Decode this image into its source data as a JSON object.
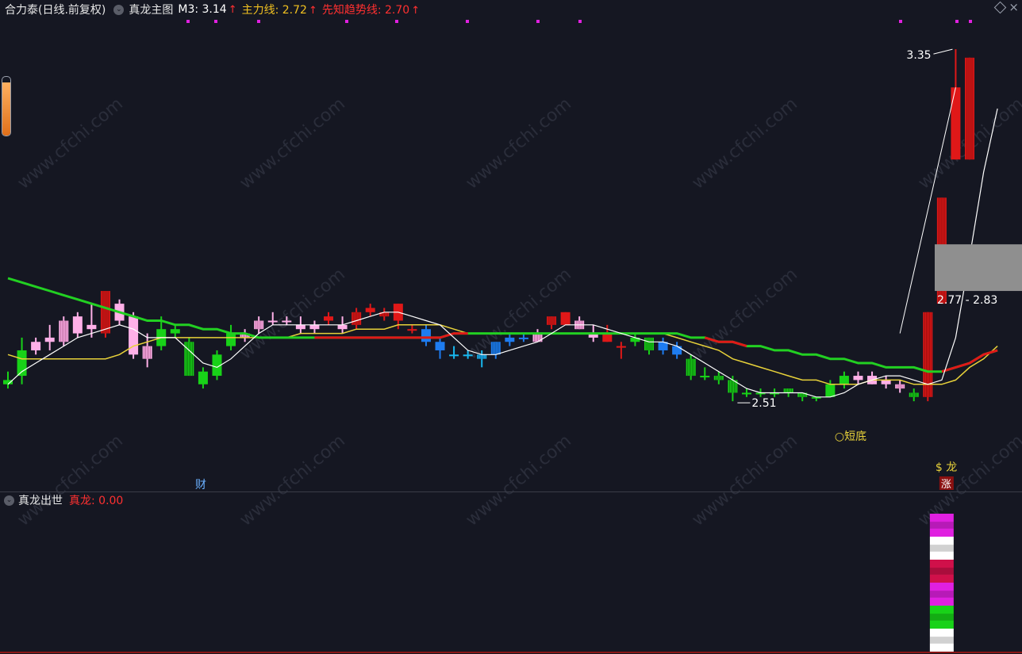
{
  "header": {
    "stock": "合力泰(日线.前复权)",
    "indicator": "真龙主图",
    "m3_label": "M3: 3.14",
    "m3_arrow": "↑",
    "main_label": "主力线: 2.72",
    "main_arrow": "↑",
    "trend_label": "先知趋势线: 2.70",
    "trend_arrow": "↑"
  },
  "sub": {
    "title": "真龙出世",
    "value_label": "真龙: 0.00"
  },
  "watermark": "www.cfchi.com",
  "colors": {
    "background": "#151722",
    "m3": "#ffffff",
    "main_line": "#e8d23a",
    "trend_green": "#22d022",
    "trend_red": "#e01818",
    "header_trend": "#ff3030",
    "header_main": "#f0c020"
  },
  "chart_data": {
    "type": "candlestick",
    "y_range": [
      2.4,
      3.4
    ],
    "price_labels": {
      "high": "3.35",
      "low": "2.51",
      "range": "2.77 - 2.83"
    },
    "signals": {
      "short_bottom": "○短底",
      "dragon": "$ 龙",
      "rise": "涨",
      "cai": "财"
    },
    "candles": [
      {
        "o": 2.55,
        "h": 2.58,
        "l": 2.54,
        "c": 2.56,
        "s": "green"
      },
      {
        "o": 2.57,
        "h": 2.66,
        "l": 2.55,
        "c": 2.63,
        "s": "green"
      },
      {
        "o": 2.63,
        "h": 2.66,
        "l": 2.62,
        "c": 2.65,
        "s": "pink"
      },
      {
        "o": 2.65,
        "h": 2.69,
        "l": 2.63,
        "c": 2.66,
        "s": "pink"
      },
      {
        "o": 2.65,
        "h": 2.71,
        "l": 2.64,
        "c": 2.7,
        "s": "pinkh"
      },
      {
        "o": 2.67,
        "h": 2.72,
        "l": 2.66,
        "c": 2.71,
        "s": "pink"
      },
      {
        "o": 2.69,
        "h": 2.74,
        "l": 2.66,
        "c": 2.68,
        "s": "pink"
      },
      {
        "o": 2.67,
        "h": 2.77,
        "l": 2.66,
        "c": 2.77,
        "s": "redh"
      },
      {
        "o": 2.7,
        "h": 2.75,
        "l": 2.69,
        "c": 2.74,
        "s": "pink"
      },
      {
        "o": 2.62,
        "h": 2.72,
        "l": 2.61,
        "c": 2.71,
        "s": "pink"
      },
      {
        "o": 2.61,
        "h": 2.67,
        "l": 2.59,
        "c": 2.64,
        "s": "pinkh"
      },
      {
        "o": 2.64,
        "h": 2.71,
        "l": 2.63,
        "c": 2.68,
        "s": "green"
      },
      {
        "o": 2.68,
        "h": 2.69,
        "l": 2.66,
        "c": 2.67,
        "s": "green"
      },
      {
        "o": 2.65,
        "h": 2.66,
        "l": 2.57,
        "c": 2.57,
        "s": "greenh"
      },
      {
        "o": 2.55,
        "h": 2.59,
        "l": 2.54,
        "c": 2.58,
        "s": "green"
      },
      {
        "o": 2.57,
        "h": 2.63,
        "l": 2.56,
        "c": 2.62,
        "s": "green"
      },
      {
        "o": 2.64,
        "h": 2.69,
        "l": 2.63,
        "c": 2.67,
        "s": "green"
      },
      {
        "o": 2.66,
        "h": 2.68,
        "l": 2.65,
        "c": 2.67,
        "s": "pinkh"
      },
      {
        "o": 2.68,
        "h": 2.71,
        "l": 2.67,
        "c": 2.7,
        "s": "pinkh"
      },
      {
        "o": 2.7,
        "h": 2.72,
        "l": 2.69,
        "c": 2.7,
        "s": "pink"
      },
      {
        "o": 2.7,
        "h": 2.71,
        "l": 2.69,
        "c": 2.7,
        "s": "pink"
      },
      {
        "o": 2.69,
        "h": 2.71,
        "l": 2.67,
        "c": 2.68,
        "s": "pink"
      },
      {
        "o": 2.69,
        "h": 2.7,
        "l": 2.67,
        "c": 2.68,
        "s": "pink"
      },
      {
        "o": 2.7,
        "h": 2.72,
        "l": 2.69,
        "c": 2.71,
        "s": "red"
      },
      {
        "o": 2.69,
        "h": 2.71,
        "l": 2.67,
        "c": 2.68,
        "s": "pink"
      },
      {
        "o": 2.69,
        "h": 2.73,
        "l": 2.68,
        "c": 2.72,
        "s": "redh"
      },
      {
        "o": 2.72,
        "h": 2.74,
        "l": 2.71,
        "c": 2.73,
        "s": "red"
      },
      {
        "o": 2.71,
        "h": 2.73,
        "l": 2.7,
        "c": 2.72,
        "s": "redh"
      },
      {
        "o": 2.7,
        "h": 2.74,
        "l": 2.68,
        "c": 2.74,
        "s": "red"
      },
      {
        "o": 2.68,
        "h": 2.69,
        "l": 2.67,
        "c": 2.68,
        "s": "red"
      },
      {
        "o": 2.68,
        "h": 2.69,
        "l": 2.64,
        "c": 2.65,
        "s": "blue"
      },
      {
        "o": 2.65,
        "h": 2.66,
        "l": 2.61,
        "c": 2.63,
        "s": "blue"
      },
      {
        "o": 2.62,
        "h": 2.64,
        "l": 2.61,
        "c": 2.62,
        "s": "cyan"
      },
      {
        "o": 2.62,
        "h": 2.63,
        "l": 2.61,
        "c": 2.62,
        "s": "cyan"
      },
      {
        "o": 2.61,
        "h": 2.63,
        "l": 2.59,
        "c": 2.62,
        "s": "cyanh"
      },
      {
        "o": 2.62,
        "h": 2.65,
        "l": 2.61,
        "c": 2.65,
        "s": "blueh"
      },
      {
        "o": 2.65,
        "h": 2.67,
        "l": 2.64,
        "c": 2.66,
        "s": "blue"
      },
      {
        "o": 2.66,
        "h": 2.67,
        "l": 2.65,
        "c": 2.66,
        "s": "blue"
      },
      {
        "o": 2.65,
        "h": 2.68,
        "l": 2.65,
        "c": 2.67,
        "s": "pinkh"
      },
      {
        "o": 2.69,
        "h": 2.71,
        "l": 2.68,
        "c": 2.71,
        "s": "redh"
      },
      {
        "o": 2.69,
        "h": 2.72,
        "l": 2.69,
        "c": 2.72,
        "s": "red"
      },
      {
        "o": 2.7,
        "h": 2.71,
        "l": 2.68,
        "c": 2.68,
        "s": "pinkh"
      },
      {
        "o": 2.67,
        "h": 2.69,
        "l": 2.65,
        "c": 2.66,
        "s": "pink"
      },
      {
        "o": 2.67,
        "h": 2.69,
        "l": 2.65,
        "c": 2.65,
        "s": "red"
      },
      {
        "o": 2.64,
        "h": 2.65,
        "l": 2.61,
        "c": 2.64,
        "s": "red"
      },
      {
        "o": 2.65,
        "h": 2.67,
        "l": 2.64,
        "c": 2.66,
        "s": "green"
      },
      {
        "o": 2.66,
        "h": 2.66,
        "l": 2.62,
        "c": 2.63,
        "s": "greenh"
      },
      {
        "o": 2.65,
        "h": 2.66,
        "l": 2.62,
        "c": 2.63,
        "s": "blue"
      },
      {
        "o": 2.64,
        "h": 2.65,
        "l": 2.61,
        "c": 2.62,
        "s": "blue"
      },
      {
        "o": 2.61,
        "h": 2.62,
        "l": 2.56,
        "c": 2.57,
        "s": "greenh"
      },
      {
        "o": 2.57,
        "h": 2.59,
        "l": 2.56,
        "c": 2.57,
        "s": "green"
      },
      {
        "o": 2.57,
        "h": 2.58,
        "l": 2.55,
        "c": 2.56,
        "s": "greenh"
      },
      {
        "o": 2.56,
        "h": 2.57,
        "l": 2.51,
        "c": 2.53,
        "s": "greenh"
      },
      {
        "o": 2.53,
        "h": 2.54,
        "l": 2.52,
        "c": 2.53,
        "s": "green"
      },
      {
        "o": 2.53,
        "h": 2.54,
        "l": 2.52,
        "c": 2.53,
        "s": "green"
      },
      {
        "o": 2.53,
        "h": 2.54,
        "l": 2.52,
        "c": 2.53,
        "s": "green"
      },
      {
        "o": 2.53,
        "h": 2.54,
        "l": 2.52,
        "c": 2.54,
        "s": "greenh"
      },
      {
        "o": 2.53,
        "h": 2.53,
        "l": 2.51,
        "c": 2.52,
        "s": "greenh"
      },
      {
        "o": 2.52,
        "h": 2.52,
        "l": 2.51,
        "c": 2.52,
        "s": "green"
      },
      {
        "o": 2.52,
        "h": 2.56,
        "l": 2.52,
        "c": 2.55,
        "s": "green"
      },
      {
        "o": 2.55,
        "h": 2.58,
        "l": 2.54,
        "c": 2.57,
        "s": "green"
      },
      {
        "o": 2.56,
        "h": 2.58,
        "l": 2.55,
        "c": 2.57,
        "s": "pink"
      },
      {
        "o": 2.55,
        "h": 2.58,
        "l": 2.55,
        "c": 2.57,
        "s": "pink"
      },
      {
        "o": 2.55,
        "h": 2.57,
        "l": 2.54,
        "c": 2.56,
        "s": "pink"
      },
      {
        "o": 2.54,
        "h": 2.56,
        "l": 2.53,
        "c": 2.55,
        "s": "pinkh"
      },
      {
        "o": 2.52,
        "h": 2.54,
        "l": 2.51,
        "c": 2.53,
        "s": "greenh"
      },
      {
        "o": 2.52,
        "h": 2.72,
        "l": 2.51,
        "c": 2.72,
        "s": "redh"
      },
      {
        "o": 2.74,
        "h": 2.99,
        "l": 2.74,
        "c": 2.99,
        "s": "redh"
      },
      {
        "o": 3.08,
        "h": 3.34,
        "l": 3.08,
        "c": 3.25,
        "s": "red"
      },
      {
        "o": 3.08,
        "h": 3.32,
        "l": 3.08,
        "c": 3.32,
        "s": "redh"
      }
    ],
    "m3": [
      2.55,
      2.58,
      2.6,
      2.62,
      2.64,
      2.66,
      2.67,
      2.68,
      2.69,
      2.68,
      2.66,
      2.66,
      2.66,
      2.63,
      2.6,
      2.59,
      2.61,
      2.64,
      2.67,
      2.69,
      2.69,
      2.69,
      2.69,
      2.69,
      2.69,
      2.7,
      2.71,
      2.72,
      2.72,
      2.71,
      2.7,
      2.69,
      2.66,
      2.63,
      2.62,
      2.62,
      2.63,
      2.64,
      2.65,
      2.67,
      2.69,
      2.69,
      2.69,
      2.68,
      2.67,
      2.66,
      2.65,
      2.65,
      2.64,
      2.62,
      2.6,
      2.58,
      2.56,
      2.54,
      2.53,
      2.53,
      2.53,
      2.53,
      2.52,
      2.52,
      2.53,
      2.55,
      2.56,
      2.57,
      2.57,
      2.56,
      2.55,
      2.56,
      2.66,
      2.85,
      3.05,
      3.2
    ],
    "main_line": [
      2.62,
      2.61,
      2.61,
      2.61,
      2.61,
      2.61,
      2.61,
      2.61,
      2.62,
      2.64,
      2.65,
      2.66,
      2.66,
      2.66,
      2.66,
      2.66,
      2.66,
      2.66,
      2.66,
      2.66,
      2.66,
      2.67,
      2.67,
      2.67,
      2.67,
      2.68,
      2.68,
      2.68,
      2.69,
      2.69,
      2.69,
      2.69,
      2.68,
      2.67,
      2.67,
      2.67,
      2.67,
      2.67,
      2.67,
      2.67,
      2.67,
      2.67,
      2.67,
      2.67,
      2.67,
      2.67,
      2.67,
      2.67,
      2.66,
      2.65,
      2.64,
      2.63,
      2.61,
      2.6,
      2.59,
      2.58,
      2.57,
      2.56,
      2.56,
      2.55,
      2.55,
      2.55,
      2.56,
      2.56,
      2.56,
      2.55,
      2.55,
      2.55,
      2.56,
      2.59,
      2.61,
      2.64
    ],
    "trend_line": [
      2.8,
      2.79,
      2.78,
      2.77,
      2.76,
      2.75,
      2.74,
      2.73,
      2.72,
      2.71,
      2.7,
      2.7,
      2.69,
      2.69,
      2.68,
      2.68,
      2.67,
      2.67,
      2.66,
      2.66,
      2.66,
      2.66,
      2.66,
      2.66,
      2.66,
      2.66,
      2.66,
      2.66,
      2.66,
      2.66,
      2.66,
      2.66,
      2.67,
      2.67,
      2.67,
      2.67,
      2.67,
      2.67,
      2.67,
      2.67,
      2.67,
      2.67,
      2.67,
      2.67,
      2.67,
      2.67,
      2.67,
      2.67,
      2.67,
      2.66,
      2.66,
      2.65,
      2.65,
      2.64,
      2.64,
      2.63,
      2.63,
      2.62,
      2.62,
      2.61,
      2.61,
      2.6,
      2.6,
      2.59,
      2.59,
      2.59,
      2.58,
      2.58,
      2.59,
      2.6,
      2.62,
      2.63
    ],
    "trend_red_ranges": [
      [
        22,
        33
      ],
      [
        50,
        53
      ],
      [
        67,
        71
      ]
    ],
    "sub_chart": {
      "bar_segments": [
        "magenta",
        "white",
        "crimson",
        "magenta",
        "green",
        "white"
      ]
    }
  }
}
